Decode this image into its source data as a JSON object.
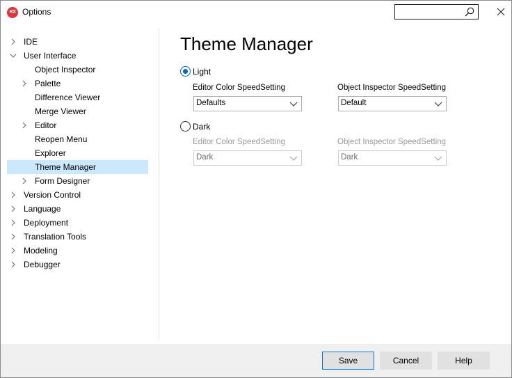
{
  "window": {
    "title": "Options",
    "app_icon_text": "RX",
    "search": {
      "value": "",
      "placeholder": ""
    }
  },
  "tree": {
    "items": [
      {
        "label": "IDE",
        "level": 0,
        "expandable": true,
        "expanded": false
      },
      {
        "label": "User Interface",
        "level": 0,
        "expandable": true,
        "expanded": true
      },
      {
        "label": "Object Inspector",
        "level": 1,
        "expandable": false
      },
      {
        "label": "Palette",
        "level": 1,
        "expandable": true,
        "expanded": false
      },
      {
        "label": "Difference Viewer",
        "level": 1,
        "expandable": false
      },
      {
        "label": "Merge Viewer",
        "level": 1,
        "expandable": false
      },
      {
        "label": "Editor",
        "level": 1,
        "expandable": true,
        "expanded": false
      },
      {
        "label": "Reopen Menu",
        "level": 1,
        "expandable": false
      },
      {
        "label": "Explorer",
        "level": 1,
        "expandable": false
      },
      {
        "label": "Theme Manager",
        "level": 1,
        "expandable": false,
        "selected": true
      },
      {
        "label": "Form Designer",
        "level": 1,
        "expandable": true,
        "expanded": false
      },
      {
        "label": "Version Control",
        "level": 0,
        "expandable": true,
        "expanded": false
      },
      {
        "label": "Language",
        "level": 0,
        "expandable": true,
        "expanded": false
      },
      {
        "label": "Deployment",
        "level": 0,
        "expandable": true,
        "expanded": false
      },
      {
        "label": "Translation Tools",
        "level": 0,
        "expandable": true,
        "expanded": false
      },
      {
        "label": "Modeling",
        "level": 0,
        "expandable": true,
        "expanded": false
      },
      {
        "label": "Debugger",
        "level": 0,
        "expandable": true,
        "expanded": false
      }
    ]
  },
  "content": {
    "title": "Theme Manager",
    "light": {
      "label": "Light",
      "checked": true,
      "editor_label": "Editor Color SpeedSetting",
      "editor_value": "Defaults",
      "inspector_label": "Object Inspector SpeedSetting",
      "inspector_value": "Default"
    },
    "dark": {
      "label": "Dark",
      "checked": false,
      "editor_label": "Editor Color SpeedSetting",
      "editor_value": "Dark",
      "inspector_label": "Object Inspector SpeedSetting",
      "inspector_value": "Dark"
    }
  },
  "footer": {
    "save_label": "Save",
    "cancel_label": "Cancel",
    "help_label": "Help"
  },
  "colors": {
    "accent": "#0066cc",
    "selection": "#cce8ff",
    "footer_bg": "#f0f0f0",
    "app_icon": "#e0353b"
  }
}
